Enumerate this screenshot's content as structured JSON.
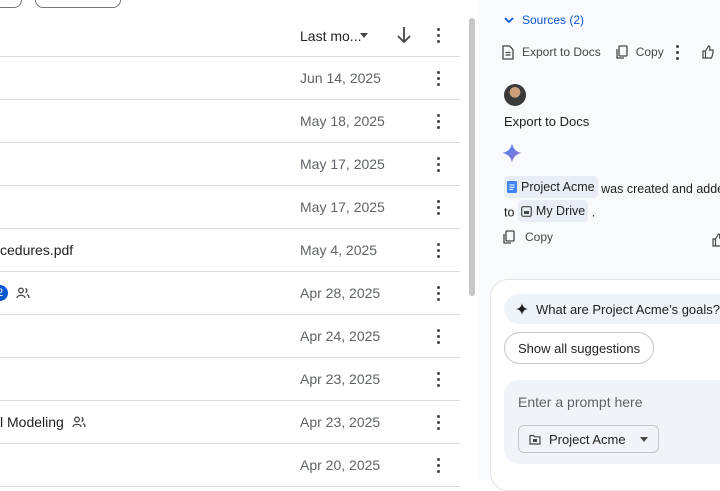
{
  "file_list": {
    "sort_column_label": "Last mo...",
    "rows": [
      {
        "name": "",
        "date": "Jun 14, 2025"
      },
      {
        "name": "",
        "date": "May 18, 2025"
      },
      {
        "name": "",
        "date": "May 17, 2025"
      },
      {
        "name": "",
        "date": "May 17, 2025"
      },
      {
        "name": "cedures.pdf",
        "date": "May 4, 2025"
      },
      {
        "name": "",
        "badge": "2",
        "shared": true,
        "date": "Apr 28, 2025"
      },
      {
        "name": "",
        "date": "Apr 24, 2025"
      },
      {
        "name": "",
        "date": "Apr 23, 2025"
      },
      {
        "name": "l Modeling",
        "shared": true,
        "date": "Apr 23, 2025"
      },
      {
        "name": "",
        "date": "Apr 20, 2025"
      }
    ]
  },
  "side_panel": {
    "sources_label": "Sources (2)",
    "actions": {
      "export": "Export to Docs",
      "copy": "Copy"
    },
    "message_title": "Export to Docs",
    "response": {
      "doc_chip": "Project Acme",
      "text_after_chip": "was created and adde",
      "to_word": "to",
      "drive_chip": "My Drive",
      "period": "."
    },
    "copy_label": "Copy",
    "suggestion": "What are Project Acme’s goals?",
    "show_all": "Show all suggestions",
    "prompt_placeholder": "Enter a prompt here",
    "project_chip": "Project Acme"
  },
  "colors": {
    "accent": "#0b57d0",
    "panel_bg": "#f8fafd",
    "chip_bg": "#e9eef6"
  }
}
